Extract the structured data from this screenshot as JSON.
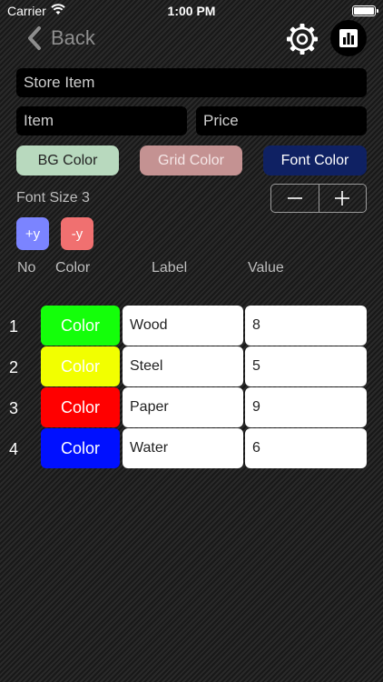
{
  "status_bar": {
    "carrier": "Carrier",
    "time": "1:00 PM"
  },
  "nav": {
    "back_label": "Back",
    "settings_icon": "gear-icon",
    "chart_icon": "bar-chart-icon"
  },
  "form": {
    "store_item_placeholder": "Store Item",
    "item_placeholder": "Item",
    "price_placeholder": "Price"
  },
  "colors": {
    "bg_color_label": "BG Color",
    "grid_color_label": "Grid Color",
    "font_color_label": "Font Color",
    "bg_color": "#b8d9be",
    "grid_color": "#c49292",
    "font_color": "#0f2163"
  },
  "font_size": {
    "label": "Font Size 3",
    "decrement_symbol": "—",
    "increment_symbol": "+"
  },
  "y_buttons": {
    "plus_label": "+y",
    "minus_label": "-y"
  },
  "table": {
    "headers": {
      "no": "No",
      "color": "Color",
      "label": "Label",
      "value": "Value"
    },
    "rows": [
      {
        "no": "1",
        "color_label": "Color",
        "color": "#14ff0a",
        "label": "Wood",
        "value": "8"
      },
      {
        "no": "2",
        "color_label": "Color",
        "color": "#f2ff00",
        "label": "Steel",
        "value": "5"
      },
      {
        "no": "3",
        "color_label": "Color",
        "color": "#ff0000",
        "label": "Paper",
        "value": "9"
      },
      {
        "no": "4",
        "color_label": "Color",
        "color": "#0010ff",
        "label": "Water",
        "value": "6"
      }
    ]
  }
}
